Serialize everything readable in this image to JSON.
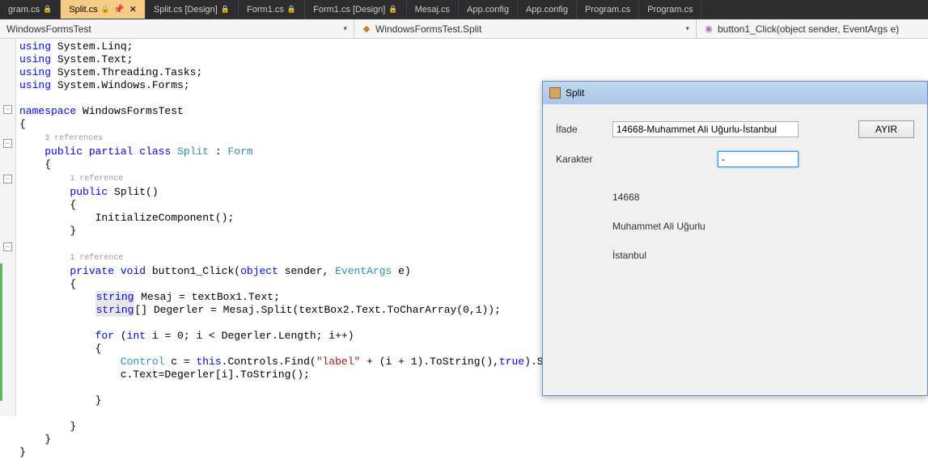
{
  "tabs": [
    {
      "label": "gram.cs",
      "locked": true
    },
    {
      "label": "Split.cs",
      "locked": true,
      "active": true,
      "pinned": true,
      "closable": true
    },
    {
      "label": "Split.cs [Design]",
      "locked": true
    },
    {
      "label": "Form1.cs",
      "locked": true
    },
    {
      "label": "Form1.cs [Design]",
      "locked": true
    },
    {
      "label": "Mesaj.cs"
    },
    {
      "label": "App.config"
    },
    {
      "label": "App.config"
    },
    {
      "label": "Program.cs"
    },
    {
      "label": "Program.cs"
    }
  ],
  "nav": {
    "namespace": "WindowsFormsTest",
    "class": "WindowsFormsTest.Split",
    "method": "button1_Click(object sender, EventArgs e)"
  },
  "code": {
    "l1": {
      "using": "using",
      "ns": " System.Linq;"
    },
    "l2": {
      "using": "using",
      "ns": " System.Text;"
    },
    "l3": {
      "using": "using",
      "ns": " System.Threading.Tasks;"
    },
    "l4": {
      "using": "using",
      "ns": " System.Windows.Forms;"
    },
    "l6": {
      "kw": "namespace",
      "txt": " WindowsFormsTest"
    },
    "l7": "{",
    "lens1": "3 references",
    "l8": {
      "p1": "public",
      "p2": "partial",
      "p3": "class",
      "nm": "Split",
      "col": " : ",
      "typ": "Form"
    },
    "l9": "    {",
    "lens2": "1 reference",
    "l10": {
      "pub": "public",
      "nm": " Split()"
    },
    "l11": "        {",
    "l12": "            InitializeComponent();",
    "l13": "        }",
    "lens3": "1 reference",
    "l15": {
      "priv": "private",
      "vd": "void",
      "nm": " button1_Click(",
      "obj": "object",
      "snd": " sender, ",
      "typ": "EventArgs",
      "e": " e)"
    },
    "l16": "        {",
    "l17": {
      "typ": "string",
      "txt": " Mesaj = textBox1.Text;"
    },
    "l18": {
      "typ": "string",
      "txt": "[] Degerler = Mesaj.Split(textBox2.Text.ToCharArray(0,1));"
    },
    "l20": {
      "fr": "for",
      "txt": " (",
      "it": "int",
      "rest": " i = 0; i < Degerler.Length; i++)"
    },
    "l21": "            {",
    "l22": {
      "typ": "Control",
      "txt": " c = ",
      "ths": "this",
      "rest": ".Controls.Find(",
      "str": "\"label\"",
      "rest2": " + (i + 1).ToString(),",
      "tr": "true",
      "rest3": ").Single();"
    },
    "l23": "                c.Text=Degerler[i].ToString();",
    "l25": "            }",
    "l27": "        }",
    "l28": "    }",
    "l29": "}"
  },
  "winform": {
    "title": "Split",
    "labels": {
      "ifade": "İfade",
      "karakter": "Karakter"
    },
    "inputs": {
      "ifade": "14668-Muhammet Ali Uğurlu-İstanbul",
      "karakter": "-"
    },
    "button": "AYIR",
    "results": [
      "14668",
      "Muhammet Ali Uğurlu",
      "İstanbul"
    ]
  }
}
